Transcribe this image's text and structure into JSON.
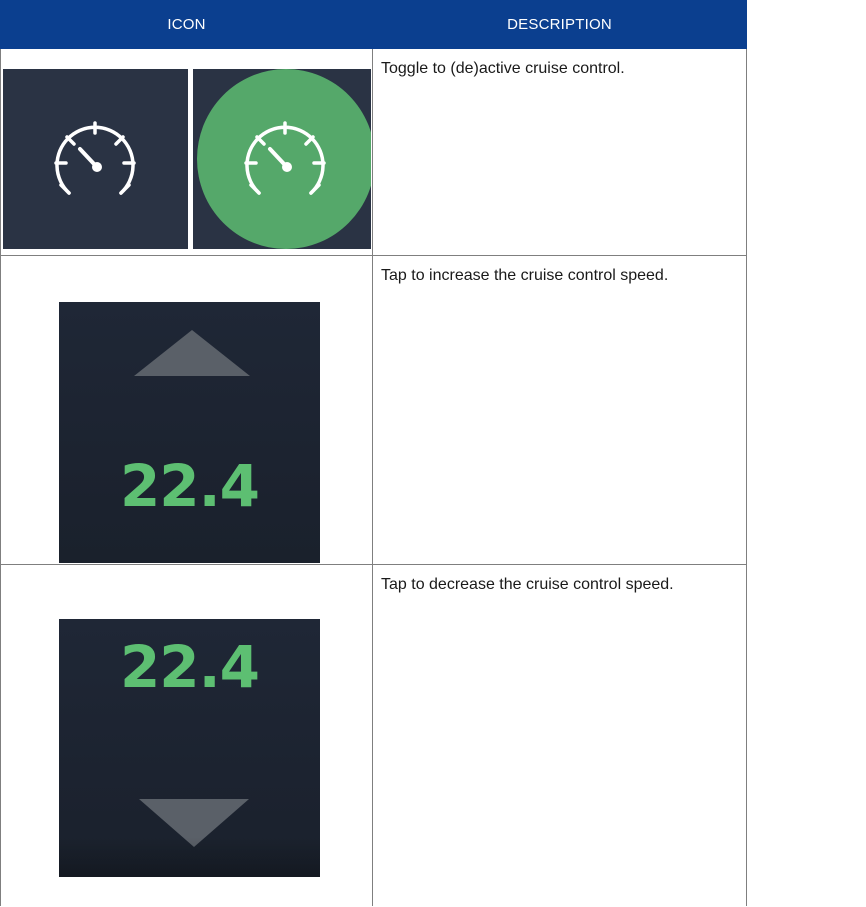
{
  "table": {
    "headers": [
      "ICON",
      "DESCRIPTION"
    ],
    "rows": [
      {
        "icon": "cruise-control-toggle-icons",
        "description": "Toggle to (de)active cruise control."
      },
      {
        "icon": "increase-speed-tile",
        "speed": "22.4",
        "description": "Tap to increase the cruise control speed."
      },
      {
        "icon": "decrease-speed-tile",
        "speed": "22.4",
        "description": "Tap to decrease the cruise control speed."
      }
    ]
  },
  "colors": {
    "header_bg": "#0b3f8f",
    "tile_bg": "#1f2736",
    "active_green": "#55a86a",
    "speed_green": "#5dbf72",
    "arrow_gray": "#5a6068"
  }
}
